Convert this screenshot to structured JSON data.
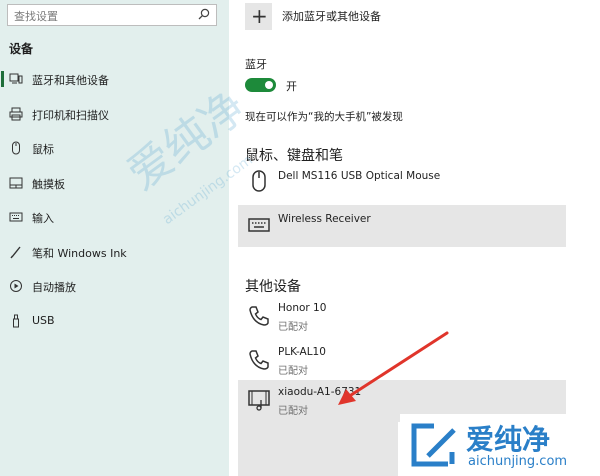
{
  "sidebar": {
    "search_placeholder": "查找设置",
    "section_title": "设备",
    "items": [
      {
        "label": "蓝牙和其他设备",
        "icon": "bluetooth-devices-icon",
        "selected": true
      },
      {
        "label": "打印机和扫描仪",
        "icon": "printer-icon",
        "selected": false
      },
      {
        "label": "鼠标",
        "icon": "mouse-icon",
        "selected": false
      },
      {
        "label": "触摸板",
        "icon": "touchpad-icon",
        "selected": false
      },
      {
        "label": "输入",
        "icon": "keyboard-icon",
        "selected": false
      },
      {
        "label": "笔和 Windows Ink",
        "icon": "pen-icon",
        "selected": false
      },
      {
        "label": "自动播放",
        "icon": "autoplay-icon",
        "selected": false
      },
      {
        "label": "USB",
        "icon": "usb-icon",
        "selected": false
      }
    ]
  },
  "main": {
    "add_device_label": "添加蓝牙或其他设备",
    "bluetooth_label": "蓝牙",
    "bluetooth_state": "开",
    "discoverable_text": "现在可以作为“我的大手机”被发现",
    "mouse_section_title": "鼠标、键盘和笔",
    "mouse_devices": [
      {
        "name": "Dell MS116 USB Optical Mouse",
        "icon": "mouse-icon",
        "status": ""
      },
      {
        "name": "Wireless Receiver",
        "icon": "keyboard-icon",
        "status": ""
      }
    ],
    "other_section_title": "其他设备",
    "other_devices": [
      {
        "name": "Honor 10",
        "icon": "phone-icon",
        "status": "已配对"
      },
      {
        "name": "PLK-AL10",
        "icon": "phone-icon",
        "status": "已配对"
      },
      {
        "name": "xiaodu-A1-6731",
        "icon": "media-device-icon",
        "status": "已配对"
      }
    ]
  },
  "watermark": {
    "cn": "爱纯净",
    "url": "aichunjing.com"
  },
  "logo": {
    "cn": "爱纯净",
    "url": "aichunjing.com"
  },
  "colors": {
    "sidebar_bg": "#e2efed",
    "accent_green": "#1d8a3a",
    "selected_row": "#e6e6e6",
    "logo_blue": "#2a7fc8",
    "arrow_red": "#e0352b"
  }
}
